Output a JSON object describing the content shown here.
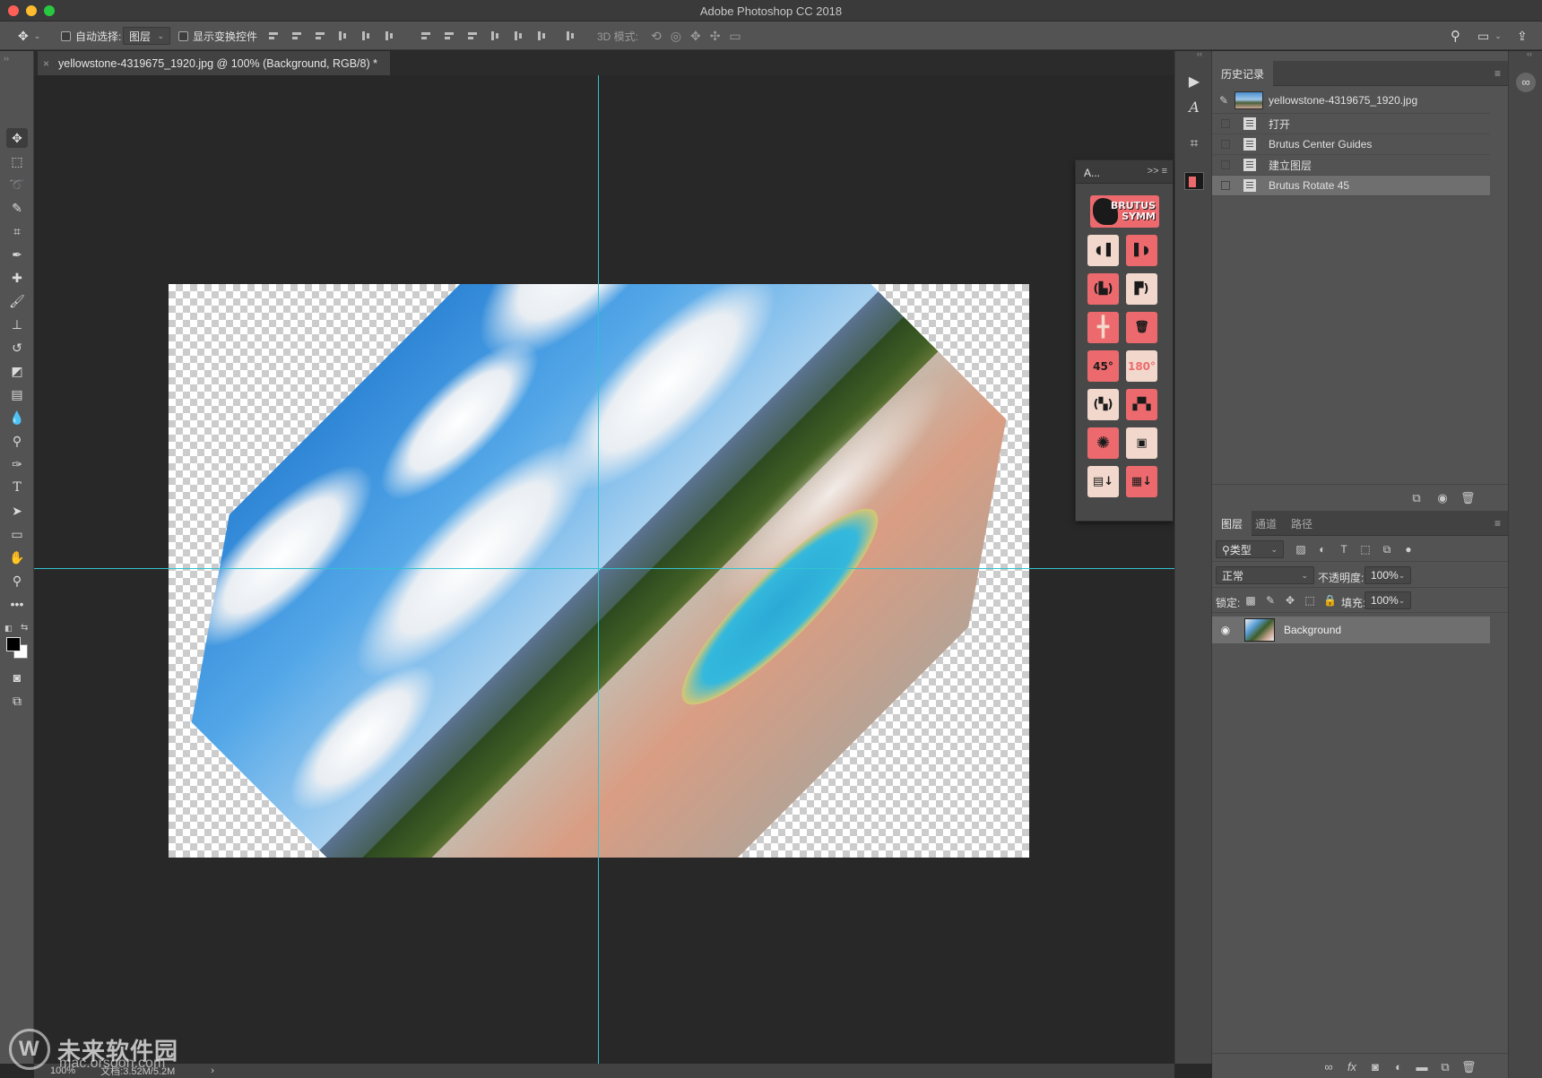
{
  "app": {
    "window_title": "Adobe Photoshop CC 2018"
  },
  "options_bar": {
    "move_tool_icon": "move-icon",
    "auto_select_label": "自动选择:",
    "auto_select_value": "图层",
    "show_transform_label": "显示变换控件",
    "mode_3d_label": "3D 模式:"
  },
  "document": {
    "tab_title": "yellowstone-4319675_1920.jpg @ 100% (Background, RGB/8) *",
    "close_glyph": "×"
  },
  "tools": [
    {
      "name": "move-tool",
      "glyph": "✥"
    },
    {
      "name": "rect-marquee-tool",
      "glyph": "⬚"
    },
    {
      "name": "lasso-tool",
      "glyph": "➰"
    },
    {
      "name": "quick-select-tool",
      "glyph": "✎"
    },
    {
      "name": "crop-tool",
      "glyph": "⌗"
    },
    {
      "name": "eyedropper-tool",
      "glyph": "✒"
    },
    {
      "name": "healing-brush-tool",
      "glyph": "✚"
    },
    {
      "name": "brush-tool",
      "glyph": "🖌"
    },
    {
      "name": "clone-stamp-tool",
      "glyph": "⊥"
    },
    {
      "name": "history-brush-tool",
      "glyph": "↺"
    },
    {
      "name": "eraser-tool",
      "glyph": "◩"
    },
    {
      "name": "gradient-tool",
      "glyph": "▤"
    },
    {
      "name": "blur-tool",
      "glyph": "💧"
    },
    {
      "name": "dodge-tool",
      "glyph": "⚲"
    },
    {
      "name": "pen-tool",
      "glyph": "✑"
    },
    {
      "name": "type-tool",
      "glyph": "T"
    },
    {
      "name": "path-select-tool",
      "glyph": "➤"
    },
    {
      "name": "rectangle-tool",
      "glyph": "▭"
    },
    {
      "name": "hand-tool",
      "glyph": "✋"
    },
    {
      "name": "zoom-tool",
      "glyph": "⚲"
    },
    {
      "name": "more-tools",
      "glyph": "•••"
    }
  ],
  "actions_panel": {
    "title": "A...",
    "controls": ">>  ≡",
    "logo_line1": "BRUTUS",
    "logo_line2": "SYMM",
    "rotate_45_label": "45°",
    "rotate_180_label": "180°"
  },
  "history_panel": {
    "tab_label": "历史记录",
    "source": "yellowstone-4319675_1920.jpg",
    "items": [
      "打开",
      "Brutus Center Guides",
      "建立图层",
      "Brutus Rotate 45"
    ],
    "selected_index": 3
  },
  "layers_panel": {
    "tabs": [
      "图层",
      "通道",
      "路径"
    ],
    "filter_label": "类型",
    "blend_mode": "正常",
    "opacity_label": "不透明度:",
    "opacity_value": "100%",
    "lock_label": "锁定:",
    "fill_label": "填充:",
    "fill_value": "100%",
    "layers": [
      {
        "name": "Background",
        "visible": true
      }
    ]
  },
  "status_bar": {
    "zoom": "100%",
    "doc_size": "文档:3.52M/5.2M",
    "arrow": "›"
  },
  "watermark": {
    "text": "未来软件园",
    "url": "mac.orsoon.com"
  },
  "colors": {
    "accent_guide": "#33c2cf",
    "brutus_red": "#ec6a6d",
    "brutus_light": "#f2d8cc"
  }
}
